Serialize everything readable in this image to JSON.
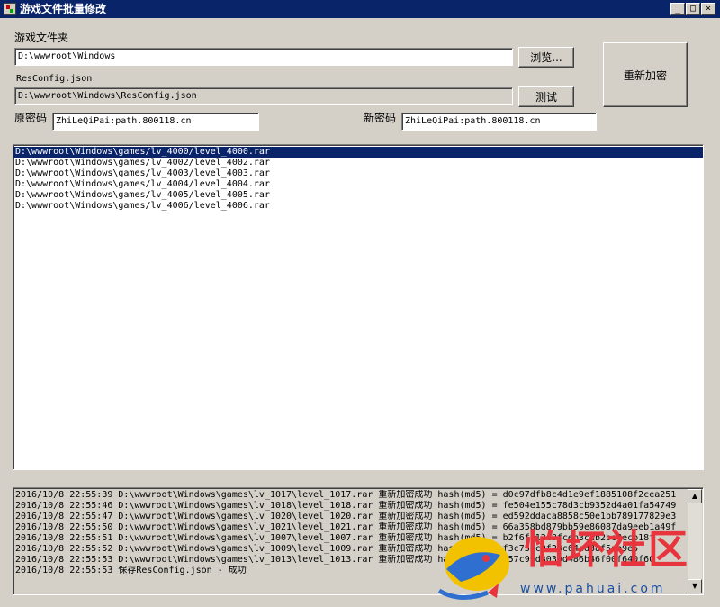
{
  "window": {
    "title": "游戏文件批量修改",
    "minimize": "_",
    "maximize": "□",
    "close": "×"
  },
  "form": {
    "folder_label": "游戏文件夹",
    "folder_value": "D:\\wwwroot\\Windows",
    "browse_button": "浏览...",
    "config_label": "ResConfig.json",
    "config_value": "D:\\wwwroot\\Windows\\ResConfig.json",
    "test_button": "测试",
    "reencrypt_button": "重新加密",
    "old_password_label": "原密码",
    "old_password_value": "ZhiLeQiPai:path.800118.cn",
    "new_password_label": "新密码",
    "new_password_value": "ZhiLeQiPai:path.800118.cn"
  },
  "file_list": [
    "D:\\wwwroot\\Windows\\games/lv_4000/level_4000.rar",
    "D:\\wwwroot\\Windows\\games/lv_4002/level_4002.rar",
    "D:\\wwwroot\\Windows\\games/lv_4003/level_4003.rar",
    "D:\\wwwroot\\Windows\\games/lv_4004/level_4004.rar",
    "D:\\wwwroot\\Windows\\games/lv_4005/level_4005.rar",
    "D:\\wwwroot\\Windows\\games/lv_4006/level_4006.rar"
  ],
  "log_lines": [
    "2016/10/8 22:55:39 D:\\wwwroot\\Windows\\games\\lv_1017\\level_1017.rar 重新加密成功 hash(md5) = d0c97dfb8c4d1e9ef1885108f2cea251",
    "2016/10/8 22:55:46 D:\\wwwroot\\Windows\\games\\lv_1018\\level_1018.rar 重新加密成功 hash(md5) = fe504e155c78d3cb9352d4a01fa54749",
    "2016/10/8 22:55:47 D:\\wwwroot\\Windows\\games\\lv_1020\\level_1020.rar 重新加密成功 hash(md5) = ed592ddaca8858c50e1bb789177829e3",
    "2016/10/8 22:55:50 D:\\wwwroot\\Windows\\games\\lv_1021\\level_1021.rar 重新加密成功 hash(md5) = 66a358bd879bb59e86087da9eeb1a49f",
    "2016/10/8 22:55:51 D:\\wwwroot\\Windows\\games\\lv_1007\\level_1007.rar 重新加密成功 hash(md5) = b2f6ff12e8fceb3ccb2be4ecb18f",
    "2016/10/8 22:55:52 D:\\wwwroot\\Windows\\games\\lv_1009\\level_1009.rar 重新加密成功 hash(md5) = f3c733c0f23c64cd38f5ab9e5",
    "2016/10/8 22:55:53 D:\\wwwroot\\Windows\\games\\lv_1013\\level_1013.rar 重新加密成功 hash(md5) = 457c90d3030d486b46f00f640f60",
    "2016/10/8 22:55:53 保存ResConfig.json - 成功"
  ],
  "watermark": {
    "text": "怕坏社区",
    "url": "www.pahuai.com"
  }
}
